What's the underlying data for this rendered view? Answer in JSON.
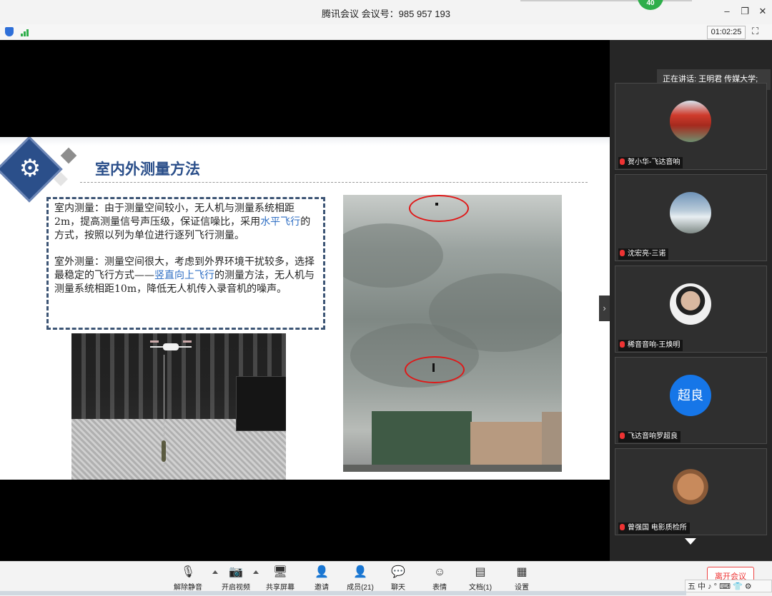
{
  "window": {
    "title": "腾讯会议 会议号：985 957 193",
    "participant_count_badge": "40",
    "minimize": "–",
    "restore": "❐",
    "close": "✕"
  },
  "status": {
    "timer": "01:02:25",
    "fullscreen": "⛶"
  },
  "slide": {
    "title": "室内外测量方法",
    "paragraph1_before": "室内测量：由于测量空间较小，无人机与测量系统相距2m，提高测量信号声压级，保证信噪比，采用",
    "paragraph1_highlight": "水平飞行",
    "paragraph1_after": "的方式，按照以列为单位进行逐列飞行测量。",
    "paragraph2_before": "室外测量：测量空间很大，考虑到外界环境干扰较多，选择最稳定的飞行方式——",
    "paragraph2_highlight": "竖直向上飞行",
    "paragraph2_after": "的测量方法，无人机与测量系统相距10m，降低无人机传入录音机的噪声。",
    "gear_symbol": "⚙",
    "next_arrow": "›"
  },
  "gallery": {
    "speaking": "正在讲话: 王明君 传媒大学;",
    "participants": [
      {
        "name": "贺小华-飞达音响",
        "avatar_text": ""
      },
      {
        "name": "沈宏亮-三诺",
        "avatar_text": ""
      },
      {
        "name": "稀音音响-王焕明",
        "avatar_text": ""
      },
      {
        "name": "飞达音响罗超良",
        "avatar_text": "超良"
      },
      {
        "name": "曾强国 电影质检所",
        "avatar_text": ""
      }
    ]
  },
  "toolbar": {
    "unmute": "解除静音",
    "video": "开启视频",
    "share": "共享屏幕",
    "invite": "邀请",
    "members": "成员(21)",
    "chat": "聊天",
    "reaction": "表情",
    "docs": "文档(1)",
    "settings": "设置",
    "leave": "离开会议"
  },
  "ime": {
    "text": "五 中 ♪ ° ⌨ 👕 ⚙"
  },
  "colors": {
    "title_blue": "#2b4f8a",
    "highlight_blue": "#2f6fc4",
    "badge_green": "#2eae4a",
    "avatar_blue": "#1676e8",
    "ellipse_red": "#e01818"
  }
}
